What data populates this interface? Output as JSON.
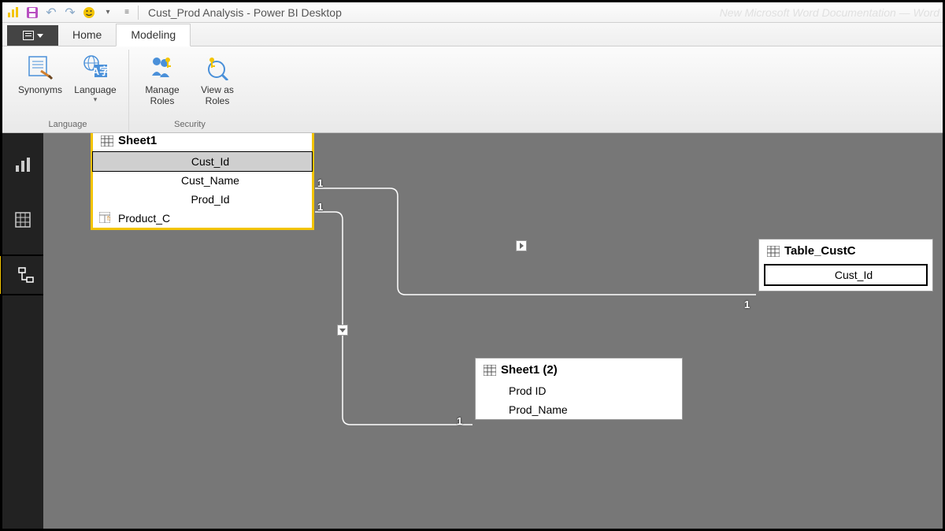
{
  "app": {
    "title": "Cust_Prod Analysis - Power BI Desktop",
    "faint_right": "New  Microsoft  Word  Documentation — Word"
  },
  "tabs": {
    "home": "Home",
    "modeling": "Modeling"
  },
  "ribbon": {
    "language_group": "Language",
    "security_group": "Security",
    "synonyms": "Synonyms",
    "language": "Language",
    "manage_roles_l1": "Manage",
    "manage_roles_l2": "Roles",
    "view_as_l1": "View as",
    "view_as_l2": "Roles"
  },
  "entities": {
    "sheet1": {
      "name": "Sheet1",
      "fields": [
        "Cust_Id",
        "Cust_Name",
        "Prod_Id",
        "Product_C"
      ]
    },
    "sheet1_2": {
      "name": "Sheet1 (2)",
      "fields": [
        "Prod ID",
        "Prod_Name"
      ]
    },
    "table_custc": {
      "name": "Table_CustC",
      "fields": [
        "Cust_Id"
      ]
    }
  },
  "cardinality": {
    "one": "1"
  }
}
